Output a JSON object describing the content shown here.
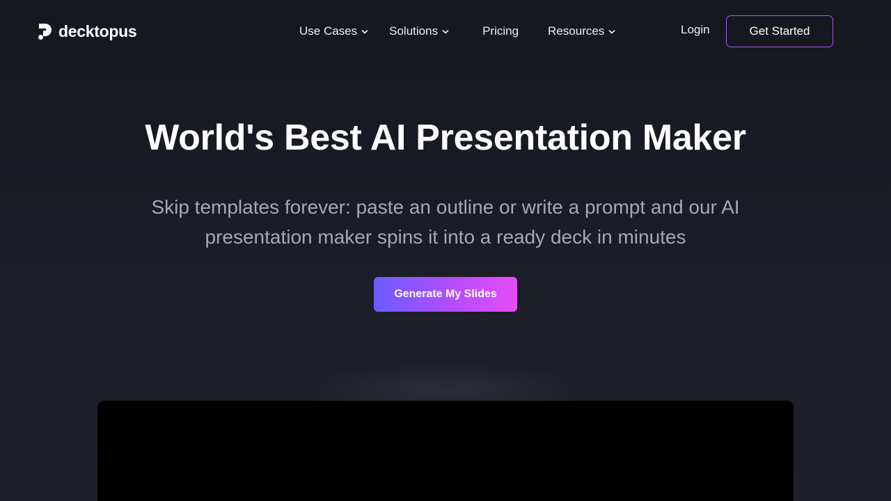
{
  "brand": {
    "name": "decktopus",
    "logo_icon": "decktopus-logo-icon"
  },
  "nav": {
    "items": [
      {
        "label": "Use Cases",
        "has_dropdown": true
      },
      {
        "label": "Solutions",
        "has_dropdown": true
      },
      {
        "label": "Pricing",
        "has_dropdown": false
      },
      {
        "label": "Resources",
        "has_dropdown": true
      }
    ],
    "login_label": "Login",
    "get_started_label": "Get Started"
  },
  "hero": {
    "title": "World's Best AI Presentation Maker",
    "subtitle": "Skip templates forever: paste an outline or write a prompt and our AI presentation maker spins it into a ready deck in minutes",
    "cta_label": "Generate My Slides"
  },
  "colors": {
    "background": "#181a23",
    "accent_start": "#6a5cff",
    "accent_end": "#e64df7",
    "border_accent": "#9b5cf0",
    "subtitle_text": "#a4a8b8"
  }
}
